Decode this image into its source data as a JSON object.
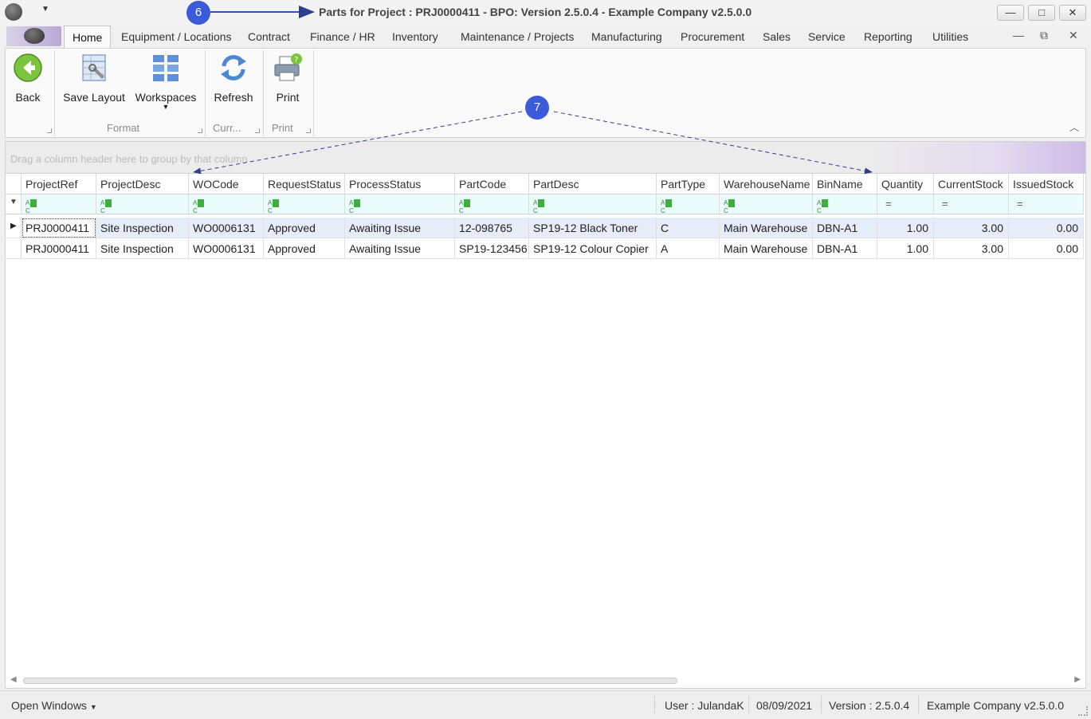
{
  "window": {
    "title": "Parts for Project : PRJ0000411 - BPO: Version 2.5.0.4 - Example Company v2.5.0.0",
    "controls": {
      "minimize": "—",
      "maximize": "□",
      "close": "✕"
    }
  },
  "annotations": {
    "top_marker": "6",
    "grid_marker": "7"
  },
  "tabs": [
    "Home",
    "Equipment / Locations",
    "Contract",
    "Finance / HR",
    "Inventory",
    "Maintenance / Projects",
    "Manufacturing",
    "Procurement",
    "Sales",
    "Service",
    "Reporting",
    "Utilities"
  ],
  "active_tab": "Home",
  "mdi": {
    "minimize": "—",
    "restore": "⧉",
    "close": "✕"
  },
  "ribbon": {
    "buttons": {
      "back": "Back",
      "save_layout": "Save Layout",
      "workspaces": "Workspaces",
      "refresh": "Refresh",
      "print": "Print"
    },
    "groups": {
      "format": "Format",
      "current": "Curr...",
      "print": "Print"
    }
  },
  "grid": {
    "group_hint": "Drag a column header here to group by that column",
    "columns": [
      "ProjectRef",
      "ProjectDesc",
      "WOCode",
      "RequestStatus",
      "ProcessStatus",
      "PartCode",
      "PartDesc",
      "PartType",
      "WarehouseName",
      "BinName",
      "Quantity",
      "CurrentStock",
      "IssuedStock"
    ],
    "rows": [
      [
        "PRJ0000411",
        "Site Inspection",
        "WO0006131",
        "Approved",
        "Awaiting Issue",
        "12-098765",
        "SP19-12 Black Toner",
        "C",
        "Main Warehouse",
        "DBN-A1",
        "1.00",
        "3.00",
        "0.00"
      ],
      [
        "PRJ0000411",
        "Site Inspection",
        "WO0006131",
        "Approved",
        "Awaiting Issue",
        "SP19-123456",
        "SP19-12 Colour Copier",
        "A",
        "Main Warehouse",
        "DBN-A1",
        "1.00",
        "3.00",
        "0.00"
      ]
    ]
  },
  "statusbar": {
    "open_windows": "Open Windows",
    "user": "User : JulandaK",
    "date": "08/09/2021",
    "version": "Version : 2.5.0.4",
    "company": "Example Company v2.5.0.0"
  },
  "colors": {
    "accent": "#3b5bdb",
    "filter_row": "#eafcfb",
    "selected_row": "#e7edf8"
  }
}
